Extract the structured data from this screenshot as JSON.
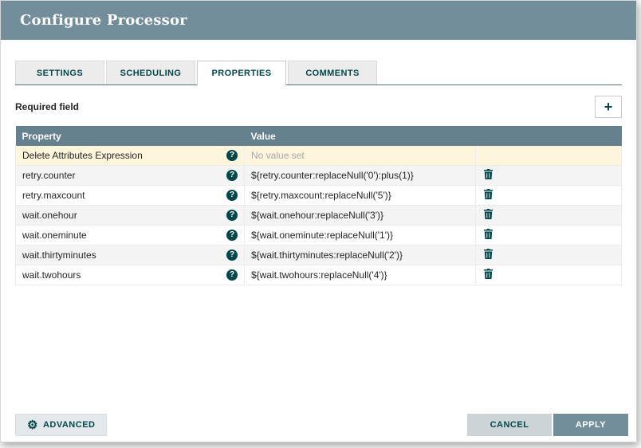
{
  "dialog": {
    "title": "Configure Processor"
  },
  "tabs": [
    {
      "label": "SETTINGS",
      "active": false
    },
    {
      "label": "SCHEDULING",
      "active": false
    },
    {
      "label": "PROPERTIES",
      "active": true
    },
    {
      "label": "COMMENTS",
      "active": false
    }
  ],
  "toolbar": {
    "required_field_label": "Required field",
    "add_button_icon": "+"
  },
  "table": {
    "headers": [
      "Property",
      "Value"
    ],
    "rows": [
      {
        "property": "Delete Attributes Expression",
        "value": "No value set",
        "value_empty": true,
        "highlighted": true,
        "deletable": false
      },
      {
        "property": "retry.counter",
        "value": "${retry.counter:replaceNull('0'):plus(1)}",
        "value_empty": false,
        "highlighted": false,
        "deletable": true
      },
      {
        "property": "retry.maxcount",
        "value": "${retry.maxcount:replaceNull('5')}",
        "value_empty": false,
        "highlighted": false,
        "deletable": true
      },
      {
        "property": "wait.onehour",
        "value": "${wait.onehour:replaceNull('3')}",
        "value_empty": false,
        "highlighted": false,
        "deletable": true
      },
      {
        "property": "wait.oneminute",
        "value": "${wait.oneminute:replaceNull('1')}",
        "value_empty": false,
        "highlighted": false,
        "deletable": true
      },
      {
        "property": "wait.thirtyminutes",
        "value": "${wait.thirtyminutes:replaceNull('2')}",
        "value_empty": false,
        "highlighted": false,
        "deletable": true
      },
      {
        "property": "wait.twohours",
        "value": "${wait.twohours:replaceNull('4')}",
        "value_empty": false,
        "highlighted": false,
        "deletable": true
      }
    ]
  },
  "footer": {
    "advanced_label": "ADVANCED",
    "cancel_label": "CANCEL",
    "apply_label": "APPLY"
  },
  "colors": {
    "header_bg": "#728e9b",
    "table_header_bg": "#66818e",
    "accent": "#004849",
    "highlight_row_bg": "#fdf5dc",
    "apply_bg": "#728e9b",
    "cancel_bg": "#ccd4d8",
    "advanced_bg": "#e3e8eb"
  }
}
